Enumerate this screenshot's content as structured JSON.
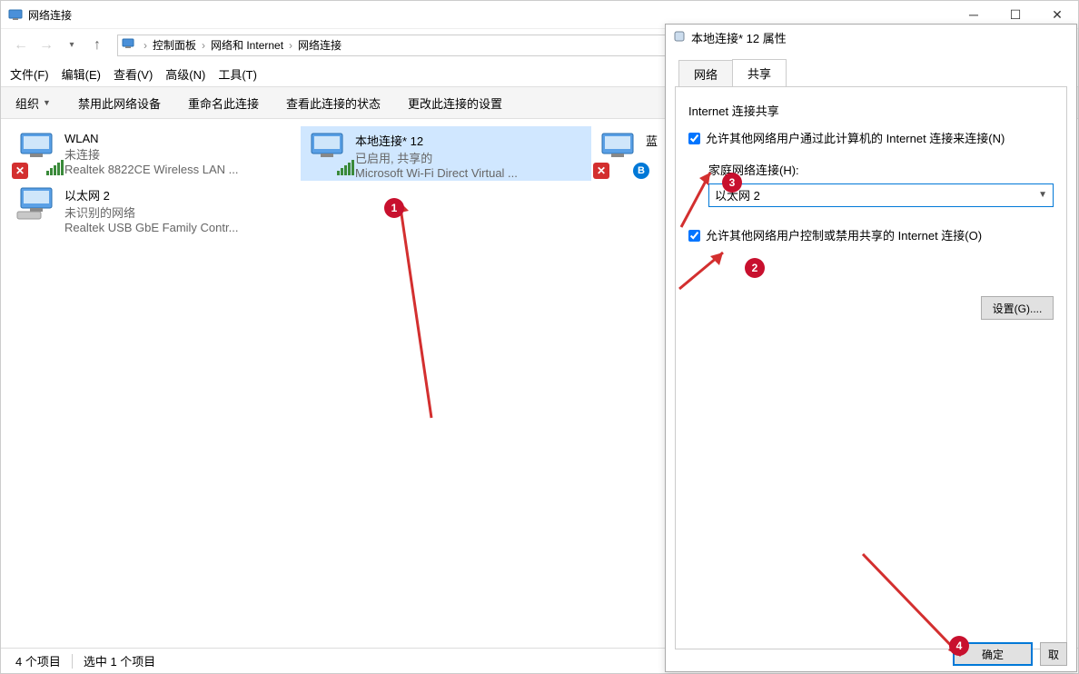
{
  "window": {
    "title": "网络连接"
  },
  "breadcrumb": {
    "part1": "控制面板",
    "part2": "网络和 Internet",
    "part3": "网络连接"
  },
  "menu": {
    "file": "文件(F)",
    "edit": "编辑(E)",
    "view": "查看(V)",
    "advanced": "高级(N)",
    "tools": "工具(T)"
  },
  "toolbar": {
    "organize": "组织",
    "disable": "禁用此网络设备",
    "rename": "重命名此连接",
    "status": "查看此连接的状态",
    "change": "更改此连接的设置"
  },
  "connections": [
    {
      "name": "WLAN",
      "status": "未连接",
      "device": "Realtek 8822CE Wireless LAN ...",
      "overlay": "x",
      "wifi": true
    },
    {
      "name": "本地连接* 12",
      "status": "已启用, 共享的",
      "device": "Microsoft Wi-Fi Direct Virtual ...",
      "selected": true,
      "wifi": true
    },
    {
      "name": "蓝",
      "status": "",
      "device": "",
      "overlay": "x",
      "bluetooth": true,
      "partial": true
    },
    {
      "name": "以太网 2",
      "status": "未识别的网络",
      "device": "Realtek USB GbE Family Contr...",
      "ethernet": true
    }
  ],
  "statusbar": {
    "count": "4 个项目",
    "selected": "选中 1 个项目"
  },
  "dialog": {
    "title": "本地连接* 12 属性",
    "tab_network": "网络",
    "tab_sharing": "共享",
    "group_label": "Internet 连接共享",
    "chk_allow": "允许其他网络用户通过此计算机的 Internet 连接来连接(N)",
    "sub_label": "家庭网络连接(H):",
    "combo_value": "以太网 2",
    "chk_control": "允许其他网络用户控制或禁用共享的 Internet 连接(O)",
    "settings_btn": "设置(G)....",
    "ok": "确定",
    "cancel": "取"
  },
  "annotations": {
    "n1": "1",
    "n2": "2",
    "n3": "3",
    "n4": "4"
  }
}
